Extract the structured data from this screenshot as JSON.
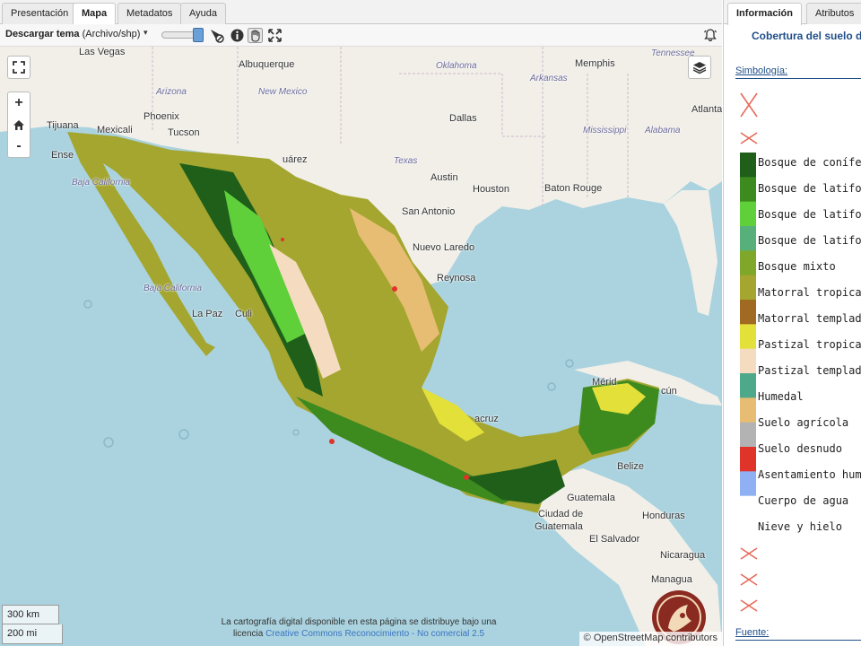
{
  "tabs": [
    {
      "label": "Presentación",
      "active": false
    },
    {
      "label": "Mapa",
      "active": true
    },
    {
      "label": "Metadatos",
      "active": false
    },
    {
      "label": "Ayuda",
      "active": false
    }
  ],
  "toolbar": {
    "download_bold": "Descargar tema",
    "download_format": " (Archivo/shp)",
    "caret": "▾"
  },
  "map": {
    "cities": [
      "Las Vegas",
      "Albuquerque",
      "Memphis",
      "Tijuana",
      "Mexicali",
      "Phoenix",
      "Tucson",
      "Dallas",
      "Atlanta",
      "Austin",
      "Houston",
      "Baton Rouge",
      "San Antonio",
      "Nuevo Laredo",
      "Reynosa",
      "La Paz",
      "Culiacán",
      "Ensenada",
      "Mérida",
      "Cancún",
      "Belize",
      "Guatemala",
      "Ciudad de Guatemala",
      "Honduras",
      "El Salvador",
      "Nicaragua",
      "Managua",
      "Juárez",
      "Veracruz"
    ],
    "city_labels": {
      "las_vegas": "Las Vegas",
      "albuquerque": "Albuquerque",
      "memphis": "Memphis",
      "tijuana": "Tijuana",
      "mexicali": "Mexicali",
      "phoenix": "Phoenix",
      "tucson": "Tucson",
      "dallas": "Dallas",
      "atlanta": "Atlanta",
      "austin": "Austin",
      "houston": "Houston",
      "baton_rouge": "Baton Rouge",
      "san_antonio": "San Antonio",
      "nuevo_laredo": "Nuevo Laredo",
      "reynosa": "Reynosa",
      "la_paz": "La Paz",
      "culiacan": "Culi",
      "ensenada": "Ense",
      "juarez": "uárez",
      "veracruz": "acruz",
      "merida": "Mérid",
      "cancun": "cún",
      "belize": "Belize",
      "guatemala": "Guatemala",
      "ciudad_guatemala_1": "Ciudad de",
      "ciudad_guatemala_2": "Guatemala",
      "honduras": "Honduras",
      "el_salvador": "El Salvador",
      "nicaragua": "Nicaragua",
      "managua": "Managua"
    },
    "state_labels": {
      "oklahoma": "Oklahoma",
      "arkansas": "Arkansas",
      "arizona": "Arizona",
      "new_mexico": "New Mexico",
      "texas": "Texas",
      "mississippi": "Mississippi",
      "alabama": "Alabama",
      "tennessee": "Tennessee",
      "baja_california": "Baja California",
      "baja_california_sur": "Baja California"
    },
    "zoom_in": "+",
    "zoom_out": "-",
    "scale_km": "300 km",
    "scale_mi": "200 mi",
    "license_line1": "La cartografía digital disponible en esta página se distribuye bajo una",
    "license_line2_prefix": "licencia ",
    "license_link": "Creative Commons Reconocimiento - No comercial 2.5",
    "attribution": "© OpenStreetMap contributors"
  },
  "panel": {
    "tabs": [
      {
        "label": "Información",
        "active": true
      },
      {
        "label": "Atributos",
        "active": false
      }
    ],
    "title": "Cobertura del suelo d",
    "symbology_label": "Simbología:",
    "source_label": "Fuente:",
    "legend": [
      {
        "label": "Bosque de conífera",
        "color": "#1f5f1a"
      },
      {
        "label": "Bosque de latifolia",
        "color": "#3d8a1f"
      },
      {
        "label": "Bosque de latifolia",
        "color": "#5fcf3a"
      },
      {
        "label": "Bosque de latifolia",
        "color": "#57b07a"
      },
      {
        "label": "Bosque mixto",
        "color": "#7fa82a"
      },
      {
        "label": "Matorral tropical o",
        "color": "#a4a630"
      },
      {
        "label": "Matorral templado",
        "color": "#a06a22"
      },
      {
        "label": "Pastizal tropical o s",
        "color": "#e3e03a"
      },
      {
        "label": "Pastizal templado o",
        "color": "#f5dcc0"
      },
      {
        "label": "Humedal",
        "color": "#4ea98a"
      },
      {
        "label": "Suelo agrícola",
        "color": "#e7bd73"
      },
      {
        "label": "Suelo desnudo",
        "color": "#b3b3b3"
      },
      {
        "label": "Asentamiento huma",
        "color": "#e0342a"
      },
      {
        "label": "Cuerpo de agua",
        "color": "#8fb0f2"
      },
      {
        "label": "Nieve y hielo",
        "color": "#ffffff"
      }
    ]
  },
  "colors": {
    "water": "#aad3df",
    "land": "#f2efe9",
    "accent": "#1f4e88",
    "link": "#3b73c0"
  }
}
